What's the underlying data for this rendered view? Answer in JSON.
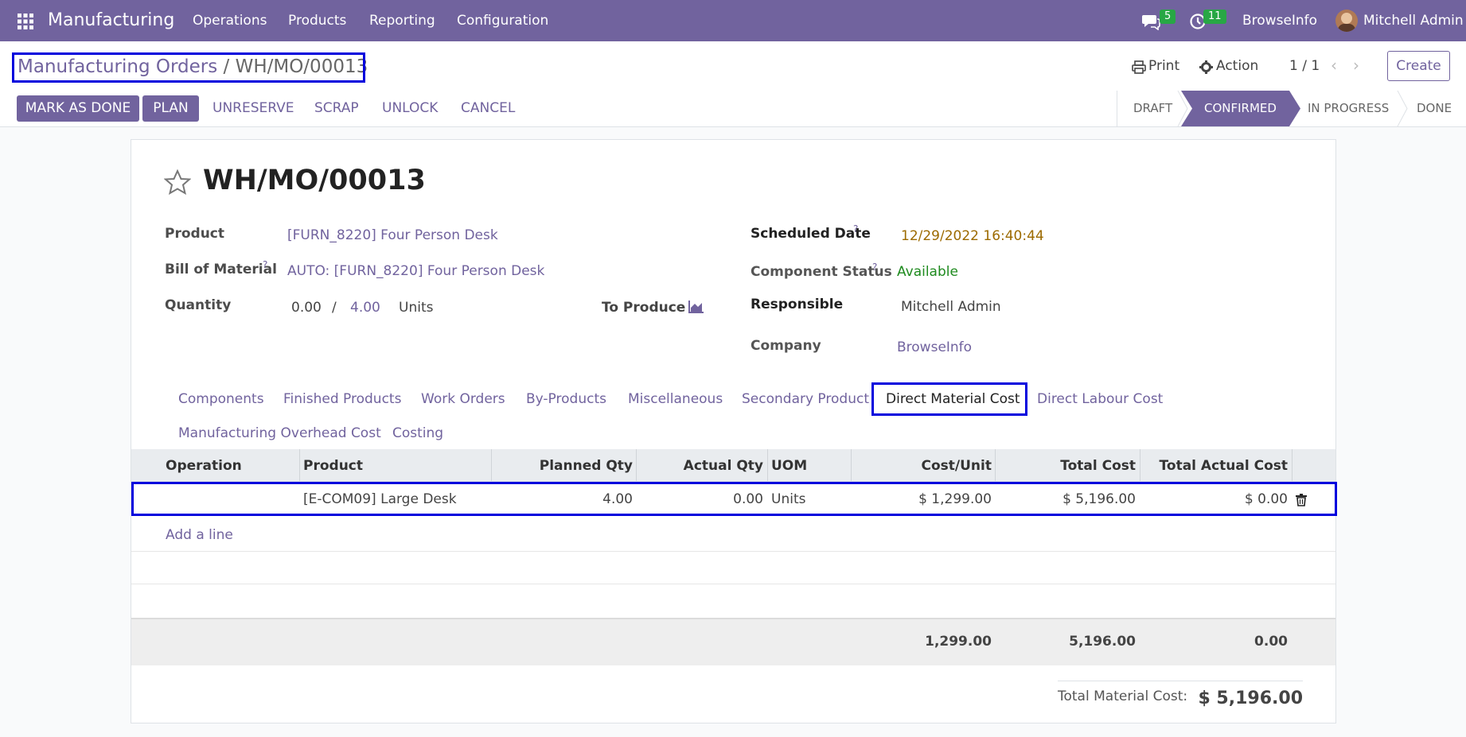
{
  "topnav": {
    "app_name": "Manufacturing",
    "menus": [
      "Operations",
      "Products",
      "Reporting",
      "Configuration"
    ],
    "messages_count": "5",
    "activities_count": "11",
    "company": "BrowseInfo",
    "user": "Mitchell Admin"
  },
  "control_panel": {
    "breadcrumb_parent": "Manufacturing Orders",
    "breadcrumb_sep": "/",
    "breadcrumb_current": "WH/MO/00013",
    "print_label": "Print",
    "action_label": "Action",
    "pager": "1 / 1",
    "create_label": "Create"
  },
  "status_bar": {
    "buttons": [
      "MARK AS DONE",
      "PLAN",
      "UNRESERVE",
      "SCRAP",
      "UNLOCK",
      "CANCEL"
    ],
    "stages": [
      "DRAFT",
      "CONFIRMED",
      "IN PROGRESS",
      "DONE"
    ],
    "active_stage": "CONFIRMED"
  },
  "form": {
    "title": "WH/MO/00013",
    "product_label": "Product",
    "product_value": "[FURN_8220] Four Person Desk",
    "bom_label": "Bill of Material",
    "bom_value": "AUTO: [FURN_8220] Four Person Desk",
    "quantity_label": "Quantity",
    "qty_produced": "0.00",
    "qty_sep": "/",
    "qty_to_produce": "4.00",
    "qty_uom": "Units",
    "to_produce_label": "To Produce",
    "scheduled_date_label": "Scheduled Date",
    "scheduled_date_value": "12/29/2022 16:40:44",
    "component_status_label": "Component Status",
    "component_status_value": "Available",
    "responsible_label": "Responsible",
    "responsible_value": "Mitchell Admin",
    "company_label": "Company",
    "company_value": "BrowseInfo",
    "help_mark": "?"
  },
  "tabs": [
    "Components",
    "Finished Products",
    "Work Orders",
    "By-Products",
    "Miscellaneous",
    "Secondary Product",
    "Direct Material Cost",
    "Direct Labour Cost",
    "Manufacturing Overhead Cost",
    "Costing"
  ],
  "active_tab": "Direct Material Cost",
  "table": {
    "headers": [
      "Operation",
      "Product",
      "Planned Qty",
      "Actual Qty",
      "UOM",
      "Cost/Unit",
      "Total Cost",
      "Total Actual Cost"
    ],
    "rows": [
      [
        "",
        "[E-COM09] Large Desk",
        "4.00",
        "0.00",
        "Units",
        "$ 1,299.00",
        "$ 5,196.00",
        "$ 0.00"
      ]
    ],
    "add_line": "Add a line",
    "footer": {
      "cost_unit": "1,299.00",
      "total_cost": "5,196.00",
      "total_actual": "0.00"
    }
  },
  "total": {
    "label": "Total Material Cost:",
    "value": "$ 5,196.00"
  },
  "colors": {
    "brand": "#71639e",
    "highlight": "#0000dd",
    "badge": "#28a745",
    "date": "#9c6a00",
    "available": "#1e8a1e"
  }
}
